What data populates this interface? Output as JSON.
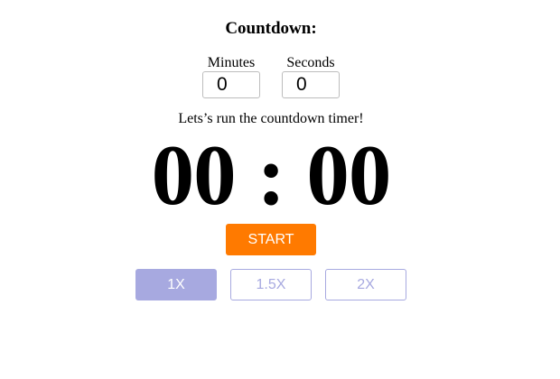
{
  "title": "Countdown:",
  "inputs": {
    "minutes": {
      "label": "Minutes",
      "value": "0"
    },
    "seconds": {
      "label": "Seconds",
      "value": "0"
    }
  },
  "message": "Lets’s run the countdown timer!",
  "timer": {
    "minutes": "00",
    "separator": ":",
    "seconds": "00"
  },
  "start_button": {
    "label": "START",
    "color": "#ff7a00"
  },
  "speed_buttons": [
    {
      "label": "1X",
      "active": true
    },
    {
      "label": "1.5X",
      "active": false
    },
    {
      "label": "2X",
      "active": false
    }
  ],
  "colors": {
    "accent": "#ff7a00",
    "speed": "#a7a9e0"
  }
}
